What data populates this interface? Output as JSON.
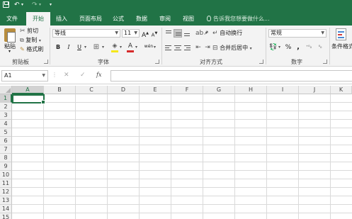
{
  "tabs": [
    {
      "label": "文件",
      "active": false
    },
    {
      "label": "开始",
      "active": true
    },
    {
      "label": "插入",
      "active": false
    },
    {
      "label": "页面布局",
      "active": false
    },
    {
      "label": "公式",
      "active": false
    },
    {
      "label": "数据",
      "active": false
    },
    {
      "label": "审阅",
      "active": false
    },
    {
      "label": "视图",
      "active": false
    }
  ],
  "tell_me": "告诉我您想要做什么...",
  "clipboard": {
    "paste": "粘贴",
    "cut": "剪切",
    "copy": "复制",
    "format_painter": "格式刷",
    "group": "剪贴板"
  },
  "font": {
    "name": "等线",
    "size": "11",
    "bold": "B",
    "italic": "I",
    "underline": "U",
    "grow": "A",
    "shrink": "A",
    "group": "字体",
    "color": "#d62b2b",
    "fill": "#f5e71c"
  },
  "alignment": {
    "wrap": "自动换行",
    "merge": "合并后居中",
    "group": "对齐方式"
  },
  "number": {
    "format": "常规",
    "percent": "%",
    "comma": ",",
    "group": "数字"
  },
  "styles": {
    "conditional": "条件格式"
  },
  "formula_bar": {
    "name_box": "A1",
    "cancel": "✕",
    "enter": "✓",
    "fx": "fx",
    "value": ""
  },
  "columns": [
    "A",
    "B",
    "C",
    "D",
    "E",
    "F",
    "G",
    "H",
    "I",
    "J",
    "K"
  ],
  "rows": [
    "1",
    "2",
    "3",
    "4",
    "5",
    "6",
    "7",
    "8",
    "9",
    "10",
    "11",
    "12",
    "13",
    "14",
    "15"
  ],
  "selected_cell": "A1",
  "colors": {
    "brand": "#217346"
  }
}
